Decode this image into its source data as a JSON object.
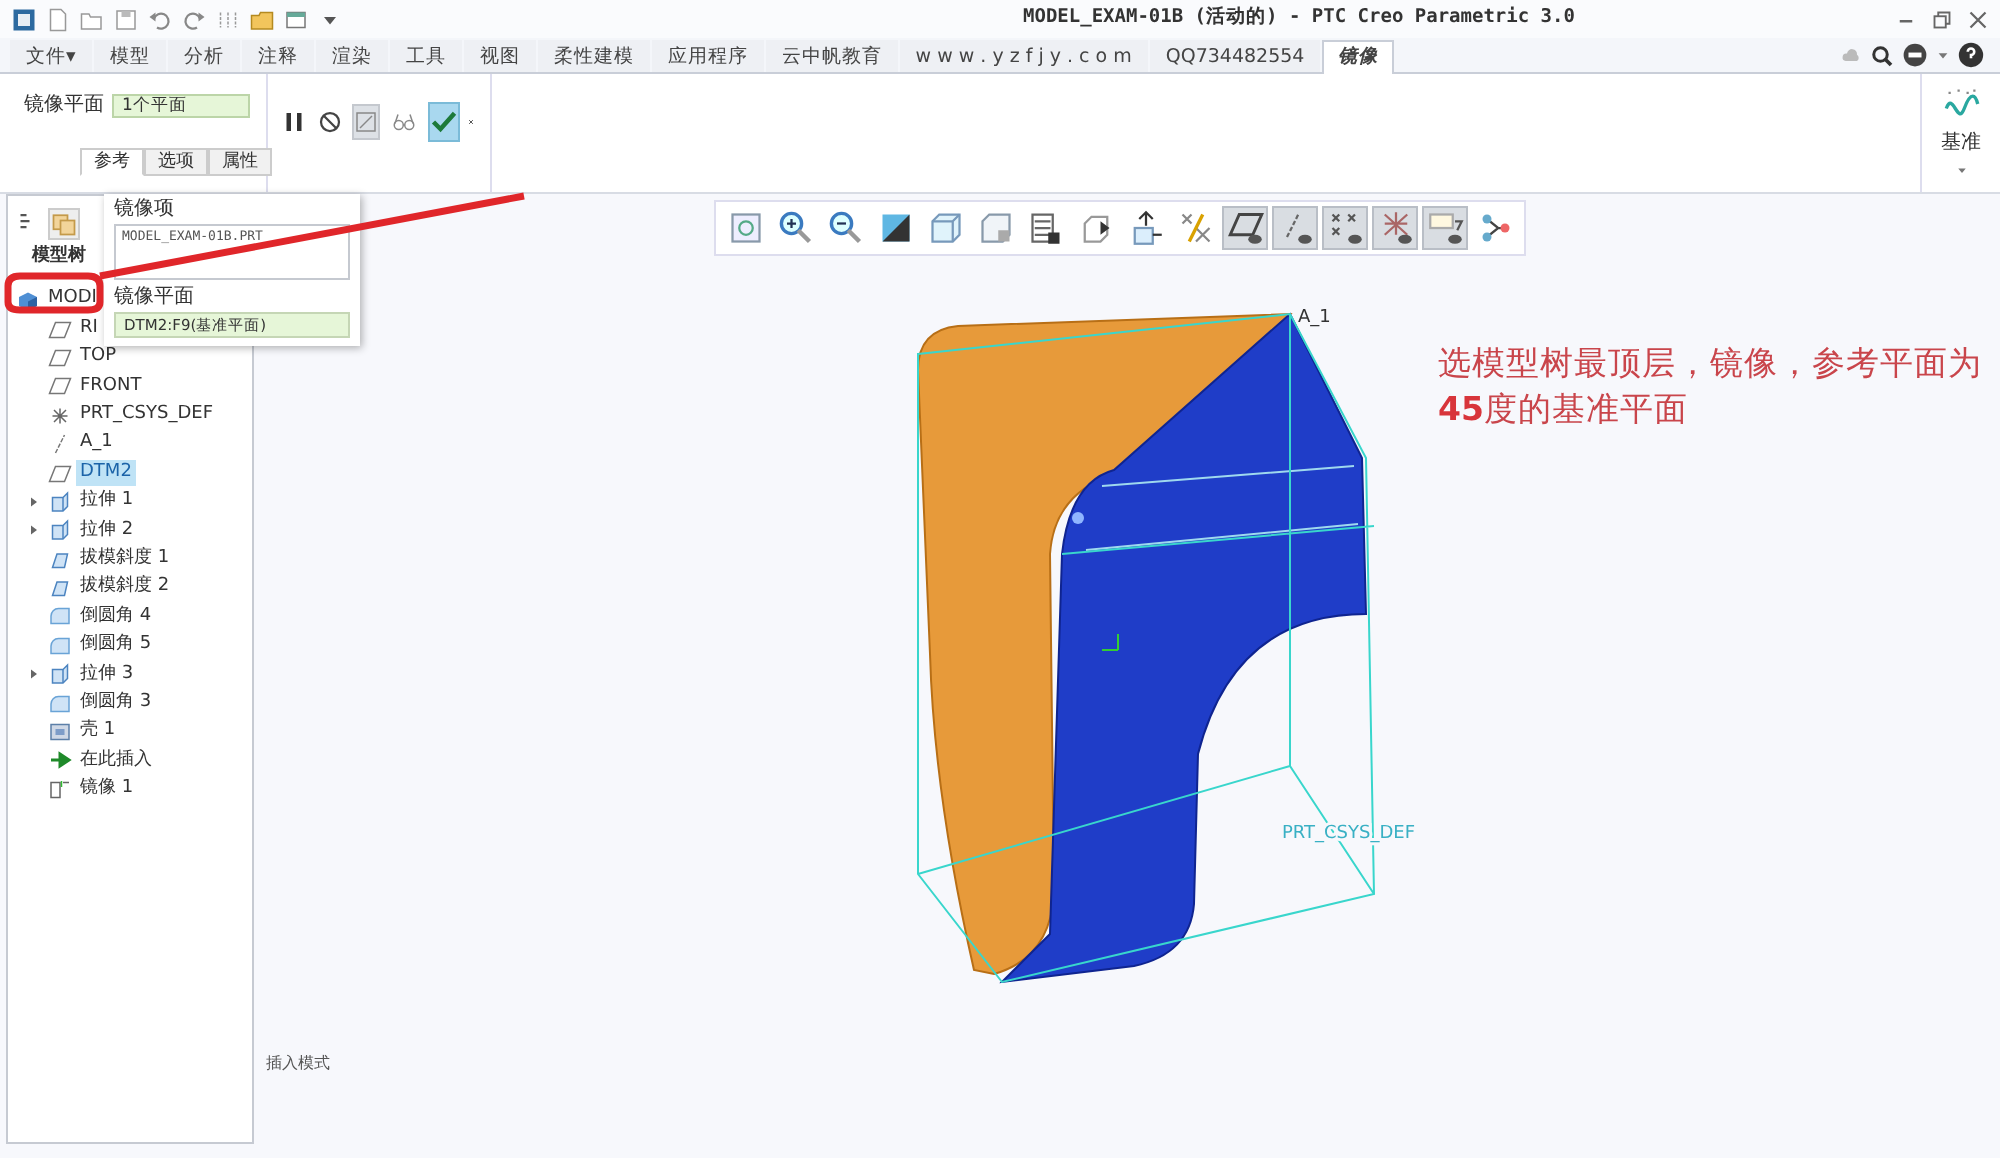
{
  "window": {
    "title": "MODEL_EXAM-01B (活动的) - PTC Creo Parametric 3.0"
  },
  "quick_access": [
    {
      "kind": "new"
    },
    {
      "kind": "open"
    },
    {
      "kind": "save"
    },
    {
      "kind": "undo"
    },
    {
      "kind": "redo"
    },
    {
      "kind": "regenerate"
    },
    {
      "kind": "folder"
    },
    {
      "kind": "windows"
    },
    {
      "kind": "more"
    }
  ],
  "ribbon_tabs": [
    {
      "label": "文件▾",
      "selected": false
    },
    {
      "label": "模型",
      "selected": false
    },
    {
      "label": "分析",
      "selected": false
    },
    {
      "label": "注释",
      "selected": false
    },
    {
      "label": "渲染",
      "selected": false
    },
    {
      "label": "工具",
      "selected": false
    },
    {
      "label": "视图",
      "selected": false
    },
    {
      "label": "柔性建模",
      "selected": false
    },
    {
      "label": "应用程序",
      "selected": false
    },
    {
      "label": "云中帆教育",
      "selected": false
    },
    {
      "label": "w w w . y z f j y . c o m",
      "selected": false
    },
    {
      "label": "QQ734482554",
      "selected": false
    },
    {
      "label": "镜像",
      "selected": true
    }
  ],
  "mirror_plane": {
    "label": "镜像平面",
    "value": "1个平面"
  },
  "sub_tabs": [
    {
      "label": "参考",
      "selected": true
    },
    {
      "label": "选项",
      "selected": false
    },
    {
      "label": "属性",
      "selected": false
    }
  ],
  "datum_group": {
    "label": "基准"
  },
  "references_panel": {
    "items_label": "镜像项",
    "items_value": "MODEL_EXAM-01B.PRT",
    "plane_label": "镜像平面",
    "plane_value": "DTM2:F9(基准平面)"
  },
  "model_tree": {
    "title": "模型树",
    "items": [
      {
        "label": "MODI",
        "kind": "part",
        "expandable": false,
        "selected": false
      },
      {
        "label": "RI",
        "kind": "plane",
        "expandable": false,
        "selected": false
      },
      {
        "label": "TOP",
        "kind": "plane",
        "expandable": false,
        "selected": false
      },
      {
        "label": "FRONT",
        "kind": "plane",
        "expandable": false,
        "selected": false
      },
      {
        "label": "PRT_CSYS_DEF",
        "kind": "csys",
        "expandable": false,
        "selected": false
      },
      {
        "label": "A_1",
        "kind": "axis",
        "expandable": false,
        "selected": false
      },
      {
        "label": "DTM2",
        "kind": "plane",
        "expandable": false,
        "selected": true
      },
      {
        "label": "拉伸 1",
        "kind": "extrude",
        "expandable": true,
        "selected": false
      },
      {
        "label": "拉伸 2",
        "kind": "extrude",
        "expandable": true,
        "selected": false
      },
      {
        "label": "拔模斜度 1",
        "kind": "draft",
        "expandable": false,
        "selected": false
      },
      {
        "label": "拔模斜度 2",
        "kind": "draft",
        "expandable": false,
        "selected": false
      },
      {
        "label": "倒圆角 4",
        "kind": "round",
        "expandable": false,
        "selected": false
      },
      {
        "label": "倒圆角 5",
        "kind": "round",
        "expandable": false,
        "selected": false
      },
      {
        "label": "拉伸 3",
        "kind": "extrude",
        "expandable": true,
        "selected": false
      },
      {
        "label": "倒圆角 3",
        "kind": "round",
        "expandable": false,
        "selected": false
      },
      {
        "label": "壳 1",
        "kind": "shell",
        "expandable": false,
        "selected": false
      },
      {
        "label": "在此插入",
        "kind": "insert",
        "expandable": false,
        "selected": false
      },
      {
        "label": "镜像 1",
        "kind": "mirror",
        "expandable": false,
        "selected": false
      }
    ]
  },
  "status": "插入模式",
  "view_toolbar": [
    {
      "kind": "refit",
      "on": false
    },
    {
      "kind": "zoom-in",
      "on": false
    },
    {
      "kind": "zoom-out",
      "on": false
    },
    {
      "kind": "reorient",
      "on": false
    },
    {
      "kind": "saved-views",
      "on": false
    },
    {
      "kind": "display-style",
      "on": false
    },
    {
      "kind": "view-manager",
      "on": false
    },
    {
      "kind": "perspective",
      "on": false
    },
    {
      "kind": "spin-center",
      "on": false
    },
    {
      "kind": "datum-display",
      "on": false
    },
    {
      "kind": "plane-display",
      "on": true
    },
    {
      "kind": "axis-display",
      "on": true
    },
    {
      "kind": "point-display",
      "on": true
    },
    {
      "kind": "csys-display",
      "on": true
    },
    {
      "kind": "annotation-display",
      "on": true
    },
    {
      "kind": "sketch-display",
      "on": false
    }
  ],
  "model_labels": [
    "A_1",
    "PRT_CSYS_DEF"
  ],
  "annotation": {
    "lines": [
      "选模型树最顶层，镜像，参考平面为",
      "**45**度的基准平面"
    ]
  }
}
